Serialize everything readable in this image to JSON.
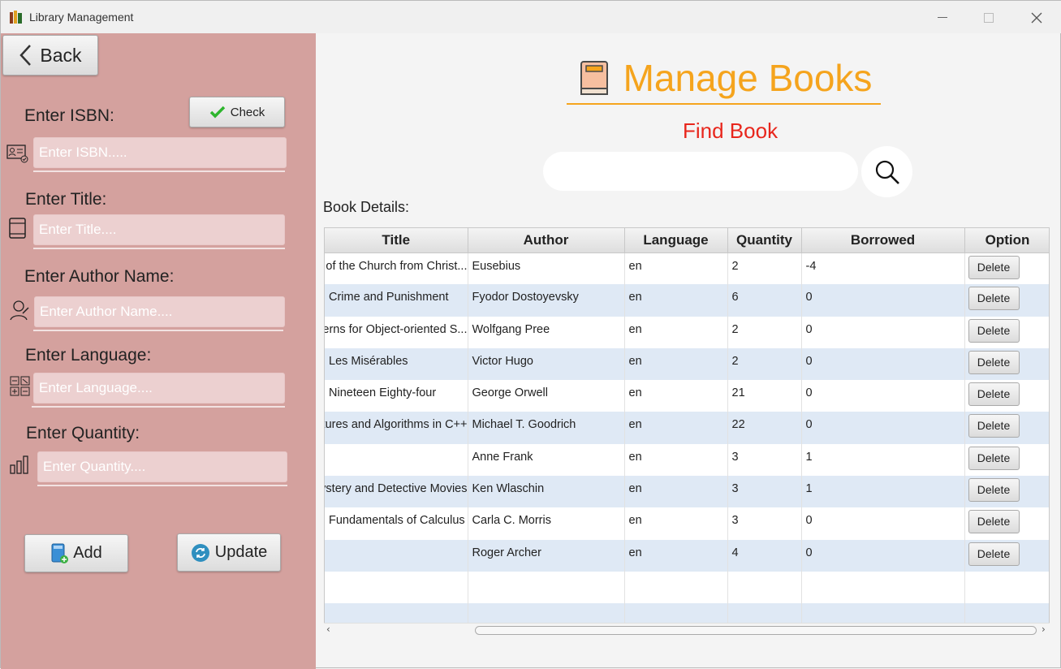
{
  "window": {
    "title": "Library Management",
    "minimize": "—",
    "maximize": "☐",
    "close": "✕"
  },
  "sidebar": {
    "back_label": "Back",
    "check_label": "Check",
    "isbn": {
      "label": "Enter ISBN:",
      "placeholder": "Enter ISBN....."
    },
    "title": {
      "label": "Enter Title:",
      "placeholder": "Enter Title...."
    },
    "author": {
      "label": "Enter Author Name:",
      "placeholder": "Enter Author Name...."
    },
    "language": {
      "label": "Enter Language:",
      "placeholder": "Enter Language...."
    },
    "quantity": {
      "label": "Enter Quantity:",
      "placeholder": "Enter Quantity...."
    },
    "add_label": "Add",
    "update_label": "Update"
  },
  "main": {
    "heading": "Manage Books",
    "find_label": "Find Book",
    "search_value": "",
    "details_label": "Book Details:",
    "columns": [
      "Title",
      "Author",
      "Language",
      "Quantity",
      "Borrowed",
      "Option"
    ],
    "rows": [
      {
        "title": "Ecclesiastical History of the Church from Christ...",
        "author": "Eusebius",
        "language": "en",
        "quantity": "2",
        "borrowed": "-4",
        "option": "Delete"
      },
      {
        "title": "Crime and Punishment",
        "author": "Fyodor Dostoyevsky",
        "language": "en",
        "quantity": "6",
        "borrowed": "0",
        "option": "Delete"
      },
      {
        "title": "Design Patterns for Object-oriented S...",
        "author": "Wolfgang Pree",
        "language": "en",
        "quantity": "2",
        "borrowed": "0",
        "option": "Delete"
      },
      {
        "title": "Les Misérables",
        "author": "Victor Hugo",
        "language": "en",
        "quantity": "2",
        "borrowed": "0",
        "option": "Delete"
      },
      {
        "title": "Nineteen Eighty-four",
        "author": "George Orwell",
        "language": "en",
        "quantity": "21",
        "borrowed": "0",
        "option": "Delete"
      },
      {
        "title": "Data Structures and Algorithms in C++",
        "author": "Michael T. Goodrich",
        "language": "en",
        "quantity": "22",
        "borrowed": "0",
        "option": "Delete"
      },
      {
        "title": "",
        "author": "Anne Frank",
        "language": "en",
        "quantity": "3",
        "borrowed": "1",
        "option": "Delete"
      },
      {
        "title": "Mystery and Detective Movies",
        "author": "Ken Wlaschin",
        "language": "en",
        "quantity": "3",
        "borrowed": "1",
        "option": "Delete"
      },
      {
        "title": "Fundamentals of Calculus",
        "author": "Carla C. Morris",
        "language": "en",
        "quantity": "3",
        "borrowed": "0",
        "option": "Delete"
      },
      {
        "title": "",
        "author": "Roger Archer",
        "language": "en",
        "quantity": "4",
        "borrowed": "0",
        "option": "Delete"
      }
    ],
    "empty_rows": 2
  },
  "colors": {
    "sidebar_bg": "#d4a19e",
    "heading": "#f5a41d",
    "find": "#e8261c",
    "row_alt": "#dfe9f5"
  }
}
